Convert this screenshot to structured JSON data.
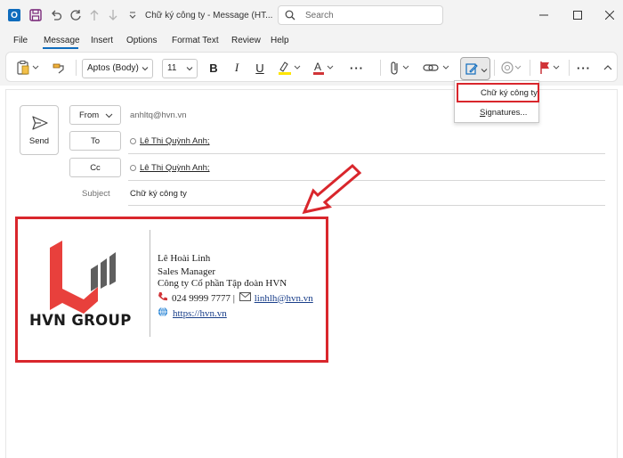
{
  "window": {
    "title": "Chữ ký công ty  -  Message (HT...",
    "search_placeholder": "Search"
  },
  "menu": {
    "tabs": [
      "File",
      "Message",
      "Insert",
      "Options",
      "Format Text",
      "Review",
      "Help"
    ],
    "active": "Message"
  },
  "ribbon": {
    "font_name": "Aptos (Body)",
    "font_size": "11",
    "more": "···"
  },
  "signature_menu": {
    "item_1": "Chữ ký công ty",
    "item_2_prefix": "S",
    "item_2_rest": "ignatures..."
  },
  "compose": {
    "send_label": "Send",
    "from_label": "From",
    "from_value": "anhltq@hvn.vn",
    "to_label": "To",
    "to_recipient": "Lê Thị Quỳnh Anh;",
    "cc_label": "Cc",
    "cc_recipient": "Lê Thị Quỳnh Anh;",
    "subject_label": "Subject",
    "subject_value": "Chữ ký công ty"
  },
  "signature": {
    "logo_text": "HVN GROUP",
    "name": "Lê Hoài Linh",
    "title": "Sales Manager",
    "company": "Công ty Cổ phần Tập đoàn HVN",
    "phone": "024 9999 7777",
    "separator": " | ",
    "email": "linhlh@hvn.vn",
    "website": "https://hvn.vn"
  },
  "colors": {
    "accent": "#0f6cbd",
    "highlight_red": "#d9262c",
    "logo_red": "#e8403c",
    "logo_gray": "#5f5f5f"
  }
}
